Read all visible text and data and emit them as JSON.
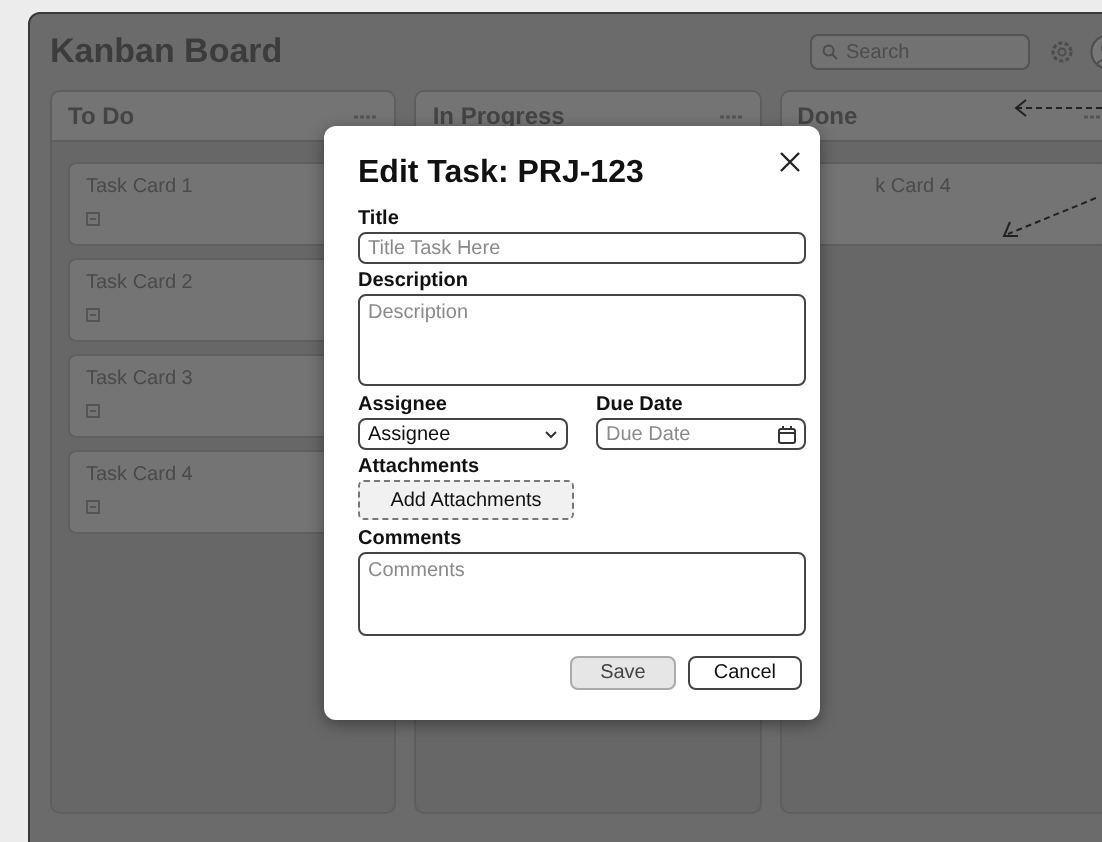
{
  "window": {
    "title": "Kanban Board"
  },
  "search": {
    "placeholder": "Search"
  },
  "columns": [
    {
      "title": "To Do",
      "cards": [
        {
          "title": "Task Card 1"
        },
        {
          "title": "Task Card 2"
        },
        {
          "title": "Task Card 3"
        },
        {
          "title": "Task Card 4"
        }
      ]
    },
    {
      "title": "In Progress"
    },
    {
      "title": "Done",
      "cards": [
        {
          "title": "k Card 4"
        }
      ]
    }
  ],
  "modal": {
    "title": "Edit Task: PRJ-123",
    "title_field": {
      "label": "Title",
      "placeholder": "Title Task Here"
    },
    "description": {
      "label": "Description",
      "placeholder": "Description"
    },
    "assignee": {
      "label": "Assignee",
      "value": "Assignee"
    },
    "due_date": {
      "label": "Due Date",
      "placeholder": "Due Date"
    },
    "attachments": {
      "label": "Attachments",
      "button": "Add Attachments"
    },
    "comments": {
      "label": "Comments",
      "placeholder": "Comments"
    },
    "buttons": [
      {
        "label": "Save",
        "kind": "primary"
      },
      {
        "label": "Cancel",
        "kind": "secondary"
      }
    ]
  }
}
